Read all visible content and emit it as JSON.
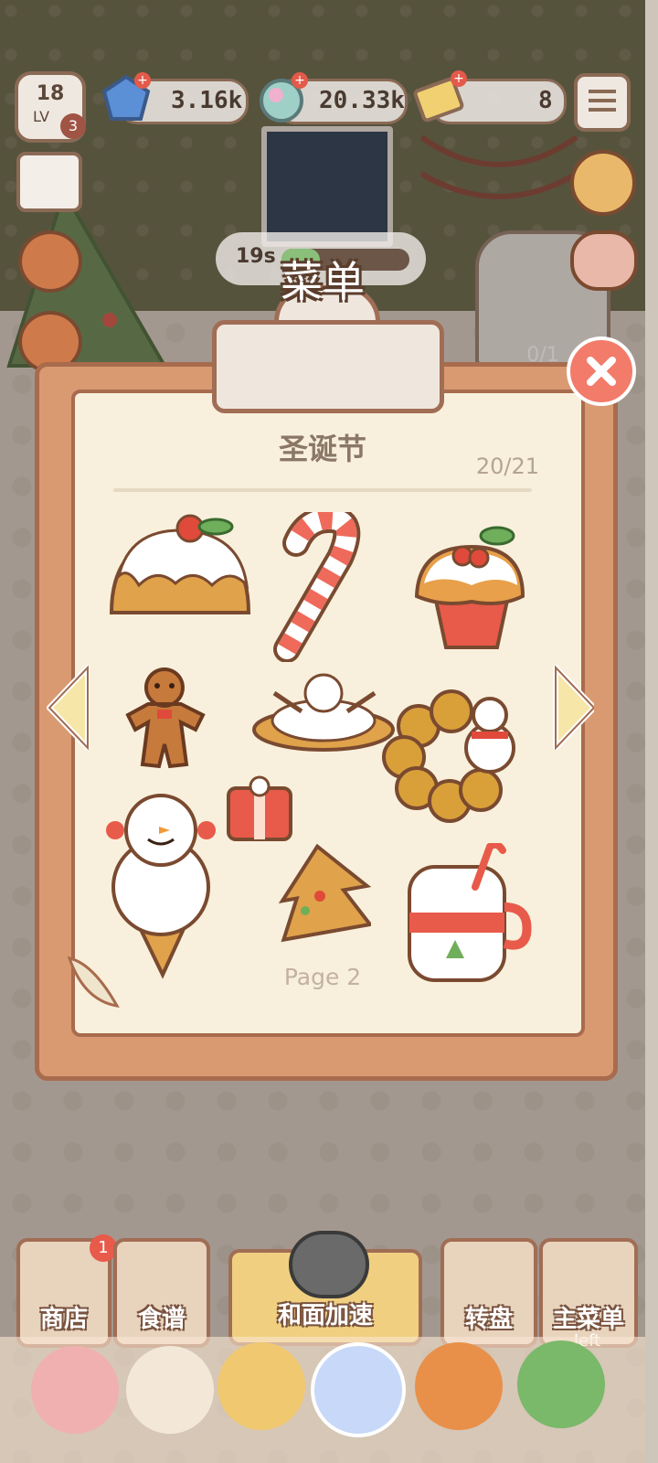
{
  "hud": {
    "level_number": "18",
    "level_label": "LV",
    "level_badge": "3",
    "gems": "3.16k",
    "orbs": "20.33k",
    "tickets": "8",
    "timer": "19s",
    "shop_progress": "0/1"
  },
  "menu": {
    "title": "菜单",
    "category": "圣诞节",
    "count": "20/21",
    "page": "Page 2"
  },
  "foods": [
    {
      "name": "圣诞布丁"
    },
    {
      "name": "拐杖糖"
    },
    {
      "name": "樱桃纸杯蛋糕"
    },
    {
      "name": "姜饼人"
    },
    {
      "name": "融化雪人"
    },
    {
      "name": "雪人甜甜圈"
    },
    {
      "name": "雪人冰淇淋"
    },
    {
      "name": "礼盒糖"
    },
    {
      "name": "圣诞树饼干"
    },
    {
      "name": "雪人杯"
    }
  ],
  "bottom": {
    "shop_label": "商店",
    "shop_badge": "1",
    "recipe_label": "食谱",
    "speed_label": "和面加速",
    "turntable_label": "转盘",
    "main_menu_label": "主菜单",
    "left_text": "left"
  },
  "colors": {
    "accent": "#f37b6a",
    "board": "#d99a72",
    "paper": "#f8f0dc",
    "outline": "#a86b4d"
  },
  "icons": [
    "level-icon",
    "gem-icon",
    "orb-icon",
    "ticket-icon",
    "list-icon",
    "calendar-icon",
    "fox-icon",
    "piggy-bank-icon",
    "close-icon",
    "arrow-left-icon",
    "arrow-right-icon",
    "flower-icon",
    "horse-icon",
    "cookie-icon",
    "ufo-icon",
    "pumpkin-icon",
    "tree-icon"
  ]
}
